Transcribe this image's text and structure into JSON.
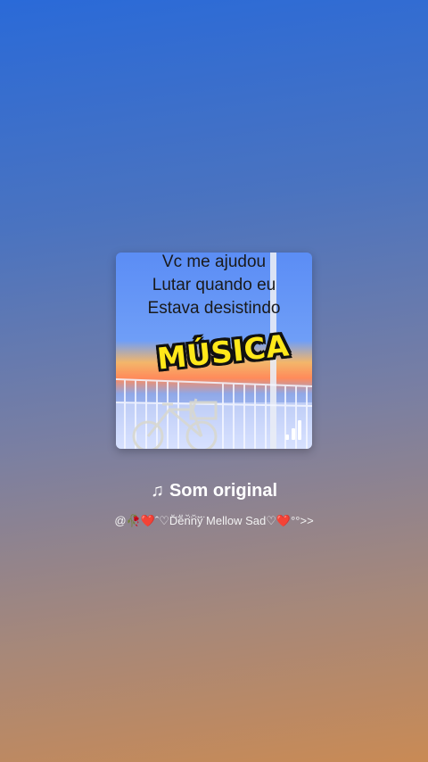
{
  "cover": {
    "caption_lines": [
      "Vc me ajudou",
      "Lutar quando eu",
      "Estava desistindo"
    ],
    "badge_text": "MÚSICA",
    "icon": "signal-bars-icon"
  },
  "sound": {
    "icon": "music-note-icon",
    "title": "Som original",
    "author": "@🥀❤️ˆ♡D̆̈ĕ̈n̆̈n̆̈y̆̈ Mellow Sad♡❤️°°>>"
  },
  "colors": {
    "background_top": "#2a6ad8",
    "background_bottom": "#c98a55",
    "badge_yellow": "#ffe81a"
  }
}
